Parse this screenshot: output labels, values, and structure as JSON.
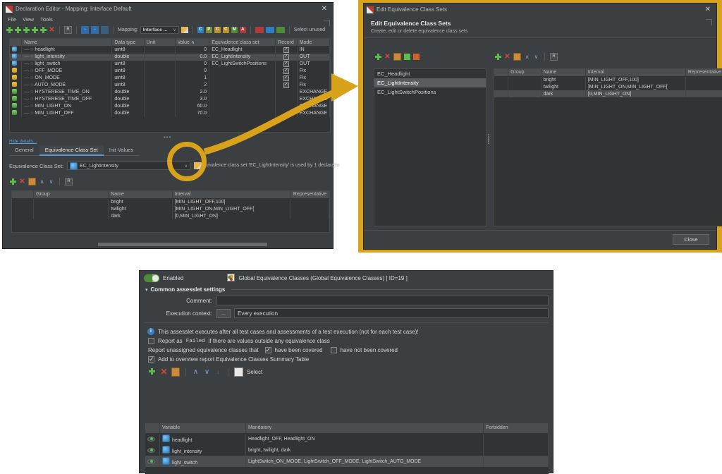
{
  "declaration_editor": {
    "title": "Declaration Editor - Mapping: Interface Default",
    "close_glyph": "✕",
    "menu": [
      "File",
      "View",
      "Tools"
    ],
    "toolbar": {
      "mapping_label": "Mapping:",
      "mapping_value": "Interface ...",
      "select_unused": "Select unused"
    },
    "grid": {
      "columns": [
        "Name",
        "Data type",
        "Unit",
        "Value ∧",
        "Equivalence class set",
        "Record",
        "Mode"
      ],
      "rows": [
        {
          "icon": "variable-icon",
          "name": "headlight",
          "type": "uint8",
          "unit": "",
          "value": "0",
          "ecs": "EC_Headlight",
          "record": true,
          "mode": "IN"
        },
        {
          "icon": "variable-icon",
          "name": "light_intensity",
          "type": "double",
          "unit": "",
          "value": "0.0",
          "ecs": "EC_LightIntensity",
          "record": true,
          "mode": "OUT"
        },
        {
          "icon": "variable-icon",
          "name": "light_switch",
          "type": "uint8",
          "unit": "",
          "value": "0",
          "ecs": "EC_LightSwitchPositions",
          "record": true,
          "mode": "OUT"
        },
        {
          "icon": "constant-icon",
          "name": "OFF_MODE",
          "type": "uint8",
          "unit": "",
          "value": "0",
          "ecs": "",
          "record": true,
          "mode": "Fix"
        },
        {
          "icon": "constant-icon",
          "name": "ON_MODE",
          "type": "uint8",
          "unit": "",
          "value": "1",
          "ecs": "",
          "record": true,
          "mode": "Fix"
        },
        {
          "icon": "constant-icon",
          "name": "AUTO_MODE",
          "type": "uint8",
          "unit": "",
          "value": "2",
          "ecs": "",
          "record": true,
          "mode": "Fix"
        },
        {
          "icon": "parameter-icon",
          "name": "HYSTERESE_TIME_ON",
          "type": "double",
          "unit": "",
          "value": "2.0",
          "ecs": "",
          "record": false,
          "mode": "EXCHANGE"
        },
        {
          "icon": "parameter-icon",
          "name": "HYSTERESE_TIME_OFF",
          "type": "double",
          "unit": "",
          "value": "3.0",
          "ecs": "",
          "record": false,
          "mode": "EXCHANGE"
        },
        {
          "icon": "parameter-icon",
          "name": "MIN_LIGHT_ON",
          "type": "double",
          "unit": "",
          "value": "60.0",
          "ecs": "",
          "record": false,
          "mode": "EXCHANGE"
        },
        {
          "icon": "parameter-icon",
          "name": "MIN_LIGHT_OFF",
          "type": "double",
          "unit": "",
          "value": "70.0",
          "ecs": "",
          "record": false,
          "mode": "EXCHANGE"
        }
      ]
    },
    "hide_details_link": "Hide details...",
    "tabs": [
      {
        "label": "General",
        "active": false
      },
      {
        "label": "Equivalence Class Set",
        "active": true
      },
      {
        "label": "Init Values",
        "active": false
      }
    ],
    "ecs_field_label": "Equivalence Class Set:",
    "ecs_field_value": "EC_LightIntensity",
    "hint_text": "...uivalence class set 'EC_LightIntensity' is used by 1 declaratio",
    "ec_table": {
      "columns": [
        "Group",
        "Name",
        "Interval",
        "Representative"
      ],
      "rows": [
        {
          "group": "",
          "name": "bright",
          "interval": "[MIN_LIGHT_OFF,100]",
          "representative": ""
        },
        {
          "group": "",
          "name": "twilight",
          "interval": "]MIN_LIGHT_ON,MIN_LIGHT_OFF[",
          "representative": ""
        },
        {
          "group": "",
          "name": "dark",
          "interval": "[0,MIN_LIGHT_ON]",
          "representative": ""
        }
      ]
    }
  },
  "edit_dialog": {
    "title": "Edit Equivalence Class Sets",
    "close_glyph": "✕",
    "heading": "Edit Equivalence Class Sets",
    "subheading": "Create, edit or delete equivalence class sets",
    "set_list": [
      {
        "label": "EC_Headlight",
        "selected": false
      },
      {
        "label": "EC_LightIntensity",
        "selected": true
      },
      {
        "label": "EC_LightSwitchPositions",
        "selected": false
      }
    ],
    "class_table": {
      "columns": [
        "Group",
        "Name",
        "Interval",
        "Representative"
      ],
      "rows": [
        {
          "group": "",
          "name": "bright",
          "interval": "[MIN_LIGHT_OFF,100]",
          "representative": "",
          "selected": false
        },
        {
          "group": "",
          "name": "twilight",
          "interval": "]MIN_LIGHT_ON,MIN_LIGHT_OFF[",
          "representative": "",
          "selected": false
        },
        {
          "group": "",
          "name": "dark",
          "interval": "[0,MIN_LIGHT_ON]",
          "representative": "",
          "selected": true
        }
      ]
    },
    "close_button": "Close"
  },
  "assesslet": {
    "enabled_label": "Enabled",
    "title": "Global Equivalence Classes (Global Equivalence Classes) [ ID=19 ]",
    "section_legend": "Common assesslet settings",
    "comment_label": "Comment:",
    "comment_value": "",
    "execution_context_label": "Execution context:",
    "execution_context_browse": "...",
    "execution_context_value": "Every execution",
    "info_text": "This assesslet executes after all test cases and assessments of a test execution (not for each test case)!",
    "report_failed": {
      "checked": false,
      "prefix": "Report as",
      "code": "Failed",
      "suffix": "if there are values outside any equivalence class"
    },
    "report_unassigned": {
      "label": "Report unassigned equivalence classes that",
      "covered_label": "have been covered",
      "covered_checked": true,
      "not_covered_label": "have not been covered",
      "not_covered_checked": false
    },
    "add_summary": {
      "checked": true,
      "label": "Add to overview report Equivalence Classes Summary Table"
    },
    "toolbar_select_label": "Select",
    "table": {
      "columns": [
        "Variable",
        "Mandatory",
        "Forbidden"
      ],
      "rows": [
        {
          "variable": "headlight",
          "mandatory": "Headlight_OFF, Headlight_ON",
          "forbidden": "",
          "selected": false
        },
        {
          "variable": "light_intensity",
          "mandatory": "bright, twilight, dark",
          "forbidden": "",
          "selected": false
        },
        {
          "variable": "light_switch",
          "mandatory": "LightSwitch_ON_MODE, LightSwitch_OFF_MODE, LightSwitch_AUTO_MODE",
          "forbidden": "",
          "selected": true
        }
      ]
    }
  },
  "annotation": {
    "highlight_color": "#d9a21b",
    "circle_target": "edit-equivalence-class-set-pencil-button"
  },
  "icons": {
    "plus": "+",
    "delete": "✕",
    "copy": "⎘",
    "up": "∧",
    "down": "∨",
    "sort": "↓",
    "caret_down": "∨",
    "check": "✓"
  }
}
